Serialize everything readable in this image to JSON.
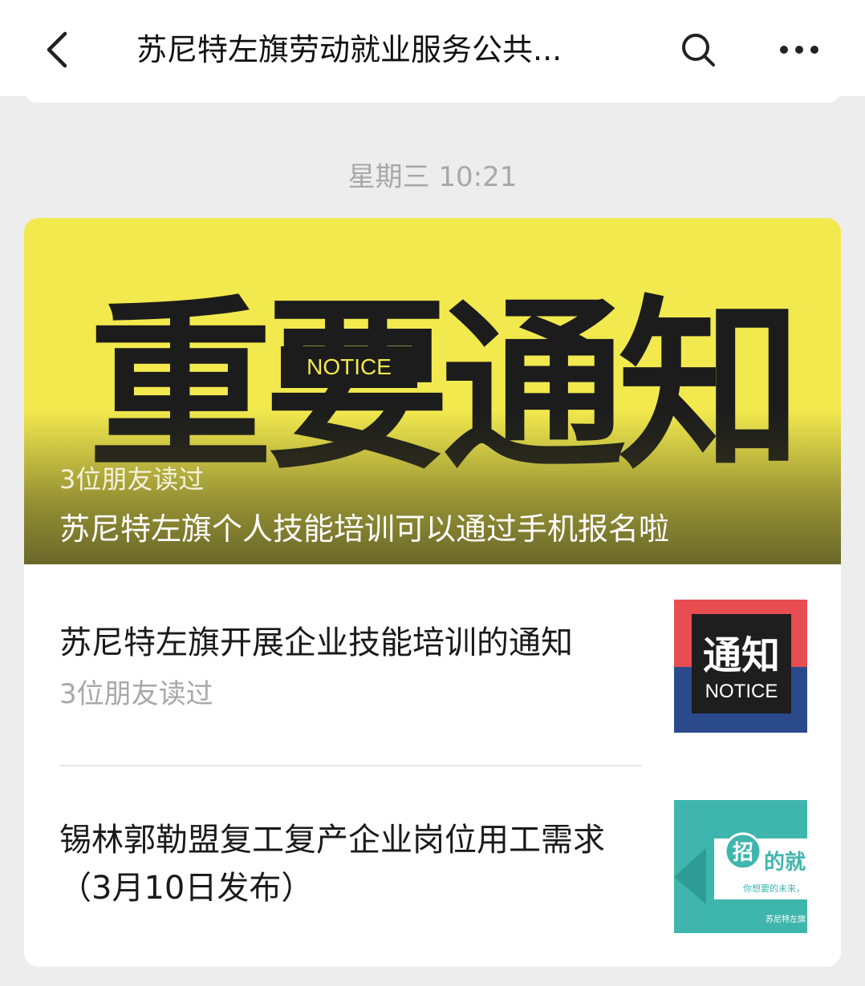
{
  "header": {
    "title": "苏尼特左旗劳动就业服务公共...",
    "back_icon": "chevron-left-icon",
    "search_icon": "search-icon",
    "more_icon": "more-dots-icon"
  },
  "timestamp": "星期三 10:21",
  "cover_article": {
    "banner_text": "重要通知",
    "banner_badge": "NOTICE",
    "readers": "3位朋友读过",
    "title": "苏尼特左旗个人技能培训可以通过手机报名啦",
    "background_color": "#f2e94e"
  },
  "articles": [
    {
      "title": "苏尼特左旗开展企业技能培训的通知",
      "readers": "3位朋友读过",
      "thumb_text": "通知",
      "thumb_sub": "NOTICE"
    },
    {
      "title": "锡林郭勒盟复工复产企业岗位用工需求（3月10日发布）",
      "thumb_badge": "招",
      "thumb_text": "的就",
      "thumb_sub": "你想要的未来，",
      "thumb_footer": "苏尼特左旗"
    }
  ]
}
